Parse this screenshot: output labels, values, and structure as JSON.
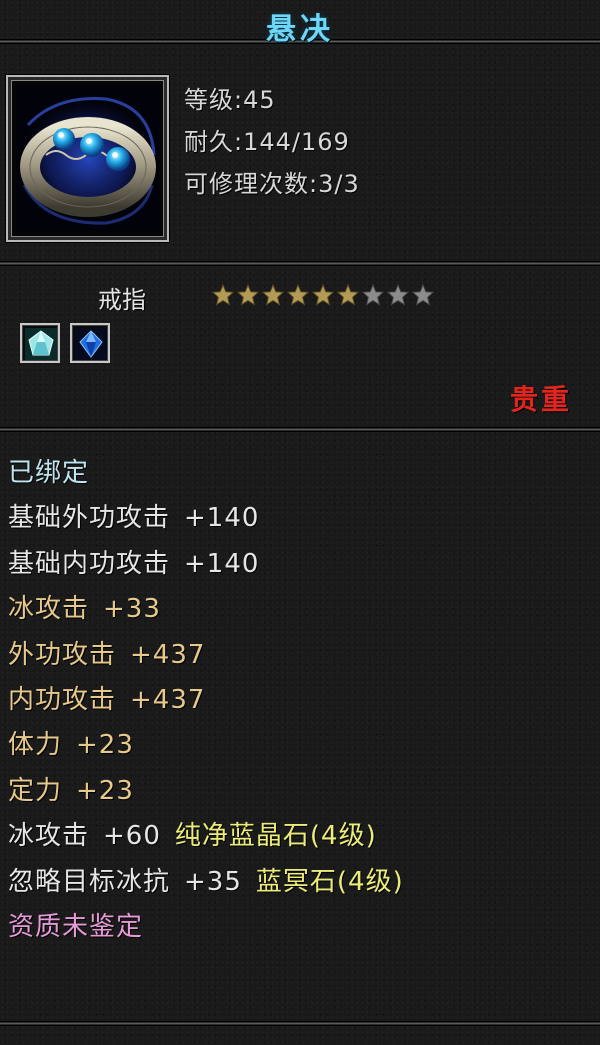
{
  "item": {
    "name": "悬决",
    "type": "戒指",
    "rarity": "贵重",
    "stats": {
      "level_label": "等级:45",
      "durability_label": "耐久:144/169",
      "repair_label": "可修理次数:3/3"
    },
    "star_rating": {
      "filled": 6,
      "total": 9
    },
    "gem_icons": [
      "crystal-gem-icon",
      "sapphire-gem-icon"
    ]
  },
  "attributes": [
    {
      "label": "已绑定",
      "value": "",
      "extra": "",
      "color": "#bfe6f0"
    },
    {
      "label": "基础外功攻击",
      "value": "+140",
      "extra": "",
      "color": "#e6e6e6"
    },
    {
      "label": "基础内功攻击",
      "value": "+140",
      "extra": "",
      "color": "#e6e6e6"
    },
    {
      "label": "冰攻击",
      "value": "+33",
      "extra": "",
      "color": "#e7c98b"
    },
    {
      "label": "外功攻击",
      "value": "+437",
      "extra": "",
      "color": "#e7c98b"
    },
    {
      "label": "内功攻击",
      "value": "+437",
      "extra": "",
      "color": "#e7c98b"
    },
    {
      "label": "体力",
      "value": "+23",
      "extra": "",
      "color": "#e7c98b"
    },
    {
      "label": "定力",
      "value": "+23",
      "extra": "",
      "color": "#e7c98b"
    },
    {
      "label": "冰攻击",
      "value": "+60",
      "extra": "纯净蓝晶石(4级)",
      "color": "#e6e6e6"
    },
    {
      "label": "忽略目标冰抗",
      "value": "+35",
      "extra": "蓝冥石(4级)",
      "color": "#e6e6e6"
    },
    {
      "label": "资质未鉴定",
      "value": "",
      "extra": "",
      "color": "#e69ad8"
    }
  ],
  "colors": {
    "title": "#6fd6f5",
    "rarity": "#e0261f",
    "gem_text": "#ecec7a",
    "star_filled": "#b39a55",
    "star_empty": "#8c8c8c"
  }
}
